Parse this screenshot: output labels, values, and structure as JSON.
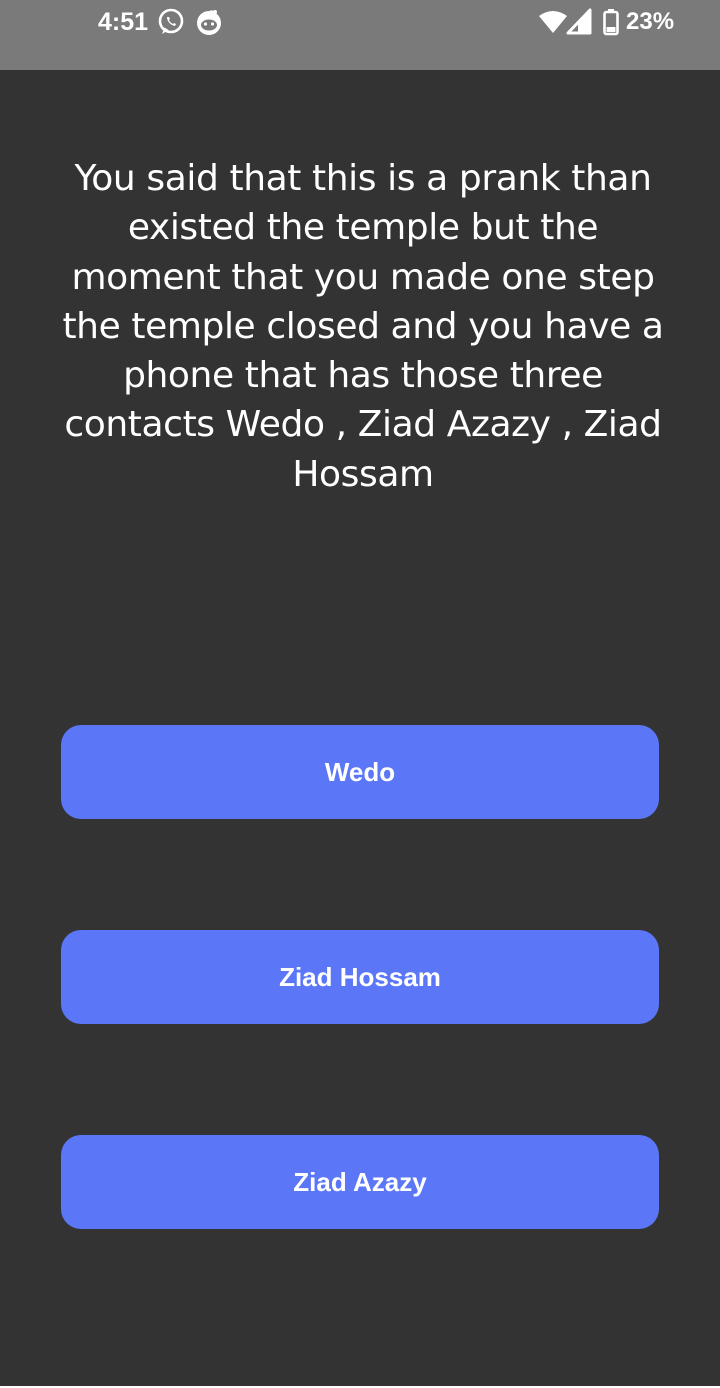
{
  "status_bar": {
    "time": "4:51",
    "battery_percent": "23%",
    "left_icons": [
      "whatsapp-icon",
      "reddit-icon"
    ],
    "right_icons": [
      "wifi-icon",
      "cell-signal-icon",
      "battery-icon"
    ]
  },
  "story": {
    "text": "You said that this is a prank than existed the temple but the moment that you made one step the temple closed and you have a phone that has those three contacts Wedo , Ziad Azazy , Ziad Hossam"
  },
  "choices": [
    {
      "label": "Wedo"
    },
    {
      "label": "Ziad Hossam"
    },
    {
      "label": "Ziad Azazy"
    }
  ],
  "colors": {
    "background": "#333333",
    "status_bar": "#7a7a7a",
    "button": "#5b77f8",
    "text": "#ffffff"
  }
}
